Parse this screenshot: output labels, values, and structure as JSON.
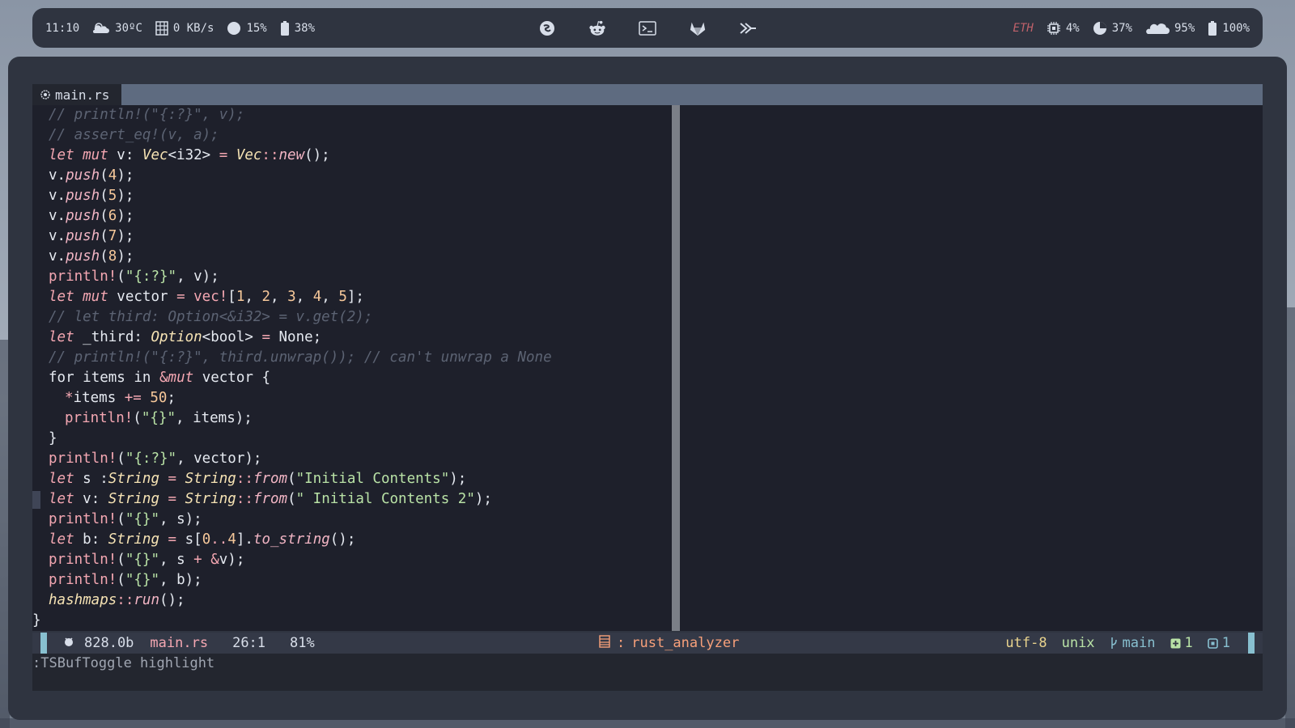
{
  "topbar": {
    "left": {
      "clock": "11:10",
      "weather": "30ºC",
      "network": "0 KB/s",
      "volume": "15%",
      "battery_small": "38%"
    },
    "center_icons": [
      "emacs-icon",
      "reddit-icon",
      "terminal-icon",
      "gitlab-icon",
      "vim-icon"
    ],
    "right": {
      "eth": "ETH",
      "cpu": "4%",
      "memory": "37%",
      "disk": "95%",
      "battery": "100%"
    }
  },
  "editor": {
    "tab": {
      "icon": "rust-icon",
      "label": "main.rs"
    },
    "lines": [
      [
        {
          "c": "cmt",
          "t": "// println!(\"{:?}\", v);"
        }
      ],
      [
        {
          "c": "cmt",
          "t": "// assert_eq!(v, a);"
        }
      ],
      [
        {
          "c": "kw",
          "t": "let mut "
        },
        {
          "c": "plain",
          "t": "v: "
        },
        {
          "c": "ty",
          "t": "Vec"
        },
        {
          "c": "plain",
          "t": "<i32> "
        },
        {
          "c": "op",
          "t": "= "
        },
        {
          "c": "ty",
          "t": "Vec"
        },
        {
          "c": "op",
          "t": "::"
        },
        {
          "c": "fn",
          "t": "new"
        },
        {
          "c": "plain",
          "t": "();"
        }
      ],
      [
        {
          "c": "plain",
          "t": "v."
        },
        {
          "c": "fn",
          "t": "push"
        },
        {
          "c": "plain",
          "t": "("
        },
        {
          "c": "num",
          "t": "4"
        },
        {
          "c": "plain",
          "t": ");"
        }
      ],
      [
        {
          "c": "plain",
          "t": "v."
        },
        {
          "c": "fn",
          "t": "push"
        },
        {
          "c": "plain",
          "t": "("
        },
        {
          "c": "num",
          "t": "5"
        },
        {
          "c": "plain",
          "t": ");"
        }
      ],
      [
        {
          "c": "plain",
          "t": "v."
        },
        {
          "c": "fn",
          "t": "push"
        },
        {
          "c": "plain",
          "t": "("
        },
        {
          "c": "num",
          "t": "6"
        },
        {
          "c": "plain",
          "t": ");"
        }
      ],
      [
        {
          "c": "plain",
          "t": "v."
        },
        {
          "c": "fn",
          "t": "push"
        },
        {
          "c": "plain",
          "t": "("
        },
        {
          "c": "num",
          "t": "7"
        },
        {
          "c": "plain",
          "t": ");"
        }
      ],
      [
        {
          "c": "plain",
          "t": "v."
        },
        {
          "c": "fn",
          "t": "push"
        },
        {
          "c": "plain",
          "t": "("
        },
        {
          "c": "num",
          "t": "8"
        },
        {
          "c": "plain",
          "t": ");"
        }
      ],
      [
        {
          "c": "mac",
          "t": "println!"
        },
        {
          "c": "plain",
          "t": "("
        },
        {
          "c": "str",
          "t": "\"{:?}\""
        },
        {
          "c": "plain",
          "t": ", v);"
        }
      ],
      [
        {
          "c": "kw",
          "t": "let mut "
        },
        {
          "c": "plain",
          "t": "vector "
        },
        {
          "c": "op",
          "t": "= "
        },
        {
          "c": "mac",
          "t": "vec!"
        },
        {
          "c": "plain",
          "t": "["
        },
        {
          "c": "num",
          "t": "1"
        },
        {
          "c": "plain",
          "t": ", "
        },
        {
          "c": "num",
          "t": "2"
        },
        {
          "c": "plain",
          "t": ", "
        },
        {
          "c": "num",
          "t": "3"
        },
        {
          "c": "plain",
          "t": ", "
        },
        {
          "c": "num",
          "t": "4"
        },
        {
          "c": "plain",
          "t": ", "
        },
        {
          "c": "num",
          "t": "5"
        },
        {
          "c": "plain",
          "t": "];"
        }
      ],
      [
        {
          "c": "cmt",
          "t": "// let third: Option<&i32> = v.get(2);"
        }
      ],
      [
        {
          "c": "kw",
          "t": "let "
        },
        {
          "c": "plain",
          "t": "_third: "
        },
        {
          "c": "ty",
          "t": "Option"
        },
        {
          "c": "plain",
          "t": "<bool> "
        },
        {
          "c": "op",
          "t": "= "
        },
        {
          "c": "plain",
          "t": "None;"
        }
      ],
      [
        {
          "c": "cmt",
          "t": "// println!(\"{:?}\", third.unwrap()); // can't unwrap a None"
        }
      ],
      [
        {
          "c": "kw2",
          "t": "for "
        },
        {
          "c": "plain",
          "t": "items "
        },
        {
          "c": "kw2",
          "t": "in "
        },
        {
          "c": "op",
          "t": "&"
        },
        {
          "c": "kw",
          "t": "mut "
        },
        {
          "c": "plain",
          "t": "vector {"
        }
      ],
      [
        {
          "c": "ind"
        },
        {
          "c": "op",
          "t": "*"
        },
        {
          "c": "plain",
          "t": "items "
        },
        {
          "c": "op",
          "t": "+= "
        },
        {
          "c": "num",
          "t": "50"
        },
        {
          "c": "plain",
          "t": ";"
        }
      ],
      [
        {
          "c": "ind"
        },
        {
          "c": "mac",
          "t": "println!"
        },
        {
          "c": "plain",
          "t": "("
        },
        {
          "c": "str",
          "t": "\"{}\""
        },
        {
          "c": "plain",
          "t": ", items);"
        }
      ],
      [
        {
          "c": "plain",
          "t": "}"
        }
      ],
      [
        {
          "c": "mac",
          "t": "println!"
        },
        {
          "c": "plain",
          "t": "("
        },
        {
          "c": "str",
          "t": "\"{:?}\""
        },
        {
          "c": "plain",
          "t": ", vector);"
        }
      ],
      [
        {
          "c": "kw",
          "t": "let "
        },
        {
          "c": "plain",
          "t": "s :"
        },
        {
          "c": "ty",
          "t": "String "
        },
        {
          "c": "op",
          "t": "= "
        },
        {
          "c": "ty",
          "t": "String"
        },
        {
          "c": "op",
          "t": "::"
        },
        {
          "c": "fn",
          "t": "from"
        },
        {
          "c": "plain",
          "t": "("
        },
        {
          "c": "str",
          "t": "\"Initial Contents\""
        },
        {
          "c": "plain",
          "t": ");"
        }
      ],
      [
        {
          "c": "kw",
          "t": "let "
        },
        {
          "c": "plain",
          "t": "v: "
        },
        {
          "c": "ty",
          "t": "String "
        },
        {
          "c": "op",
          "t": "= "
        },
        {
          "c": "ty",
          "t": "String"
        },
        {
          "c": "op",
          "t": "::"
        },
        {
          "c": "fn",
          "t": "from"
        },
        {
          "c": "plain",
          "t": "("
        },
        {
          "c": "str",
          "t": "\" Initial Contents 2\""
        },
        {
          "c": "plain",
          "t": ");"
        }
      ],
      [
        {
          "c": "mac",
          "t": "println!"
        },
        {
          "c": "plain",
          "t": "("
        },
        {
          "c": "str",
          "t": "\"{}\""
        },
        {
          "c": "plain",
          "t": ", s);"
        }
      ],
      [
        {
          "c": "kw",
          "t": "let "
        },
        {
          "c": "plain",
          "t": "b: "
        },
        {
          "c": "ty",
          "t": "String "
        },
        {
          "c": "op",
          "t": "= "
        },
        {
          "c": "plain",
          "t": "s["
        },
        {
          "c": "num",
          "t": "0"
        },
        {
          "c": "op",
          "t": ".."
        },
        {
          "c": "num",
          "t": "4"
        },
        {
          "c": "plain",
          "t": "]."
        },
        {
          "c": "fn",
          "t": "to_string"
        },
        {
          "c": "plain",
          "t": "();"
        }
      ],
      [
        {
          "c": "mac",
          "t": "println!"
        },
        {
          "c": "plain",
          "t": "("
        },
        {
          "c": "str",
          "t": "\"{}\""
        },
        {
          "c": "plain",
          "t": ", s "
        },
        {
          "c": "op",
          "t": "+ &"
        },
        {
          "c": "plain",
          "t": "v);"
        }
      ],
      [
        {
          "c": "mac",
          "t": "println!"
        },
        {
          "c": "plain",
          "t": "("
        },
        {
          "c": "str",
          "t": "\"{}\""
        },
        {
          "c": "plain",
          "t": ", b);"
        }
      ],
      [
        {
          "c": "ty",
          "t": "hashmaps"
        },
        {
          "c": "op",
          "t": "::"
        },
        {
          "c": "fn",
          "t": "run"
        },
        {
          "c": "plain",
          "t": "();"
        }
      ],
      [
        {
          "c": "outdent"
        },
        {
          "c": "plain",
          "t": "}"
        }
      ]
    ],
    "cursor_line": 19
  },
  "statusline": {
    "size": "828.0b",
    "filename": "main.rs",
    "position": "26:1",
    "percent": "81%",
    "lsp_sep": ":",
    "lsp": "rust_analyzer",
    "encoding": "utf-8",
    "fileformat": "unix",
    "branch": "main",
    "added": "1",
    "modified": "1"
  },
  "cmdline": {
    "text": ":TSBufToggle highlight"
  },
  "colors": {
    "bar_bg": "#2f3440",
    "editor_bg": "#1e202b",
    "tabline_bg": "#5e6b80",
    "accent": "#88c0d0",
    "comment": "#5c6373",
    "keyword": "#f4a7b2",
    "string": "#b9e2a6",
    "number": "#f7c89a"
  }
}
